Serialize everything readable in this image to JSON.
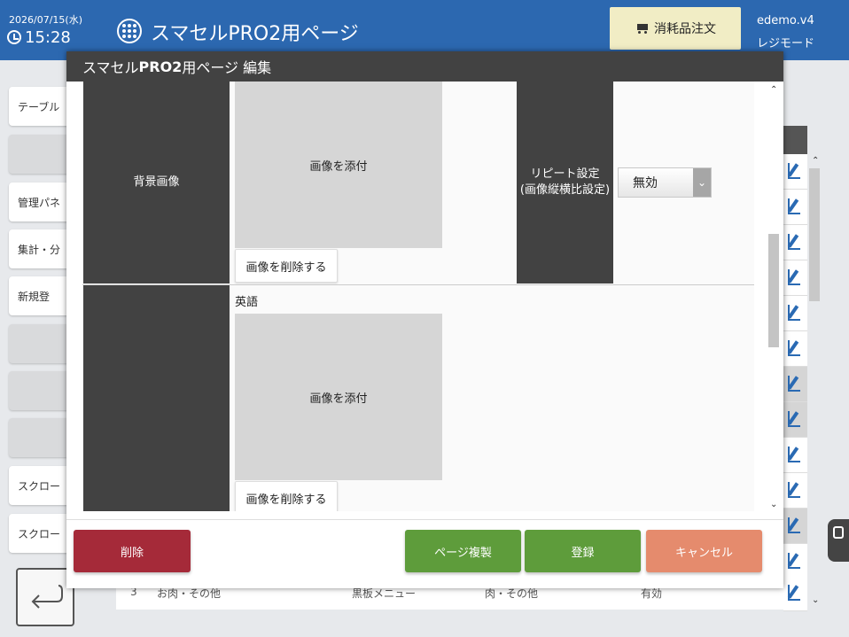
{
  "topbar": {
    "date": "2026/07/15(水)",
    "time": "15:28",
    "title": "スマセルPRO2用ページ",
    "order_button": "消耗品注文",
    "user": "edemo.v4",
    "mode": "レジモード"
  },
  "sidebar": {
    "items": [
      "テーブル",
      "",
      "管理パネ",
      "集計・分",
      "新規登",
      "",
      "",
      "",
      "スクロー",
      "スクロー"
    ]
  },
  "background_table": {
    "last_row": {
      "no": "3",
      "category": "お肉・その他",
      "col2": "黒板メニュー",
      "col3": "肉・その他",
      "status": "有効"
    }
  },
  "modal": {
    "title_prefix": "スマセル",
    "title_bold": "PRO2",
    "title_suffix": "用ページ 編集",
    "bg_image_label": "背景画像",
    "attach_image": "画像を添付",
    "attach_image_2": "画像を添付",
    "delete_image": "画像を削除する",
    "delete_image_2": "画像を削除する",
    "repeat_label_line1": "リピート設定",
    "repeat_label_line2": "(画像縦横比設定)",
    "repeat_value": "無効",
    "english_label": "英語",
    "buttons": {
      "delete": "削除",
      "duplicate": "ページ複製",
      "register": "登録",
      "cancel": "キャンセル"
    }
  }
}
